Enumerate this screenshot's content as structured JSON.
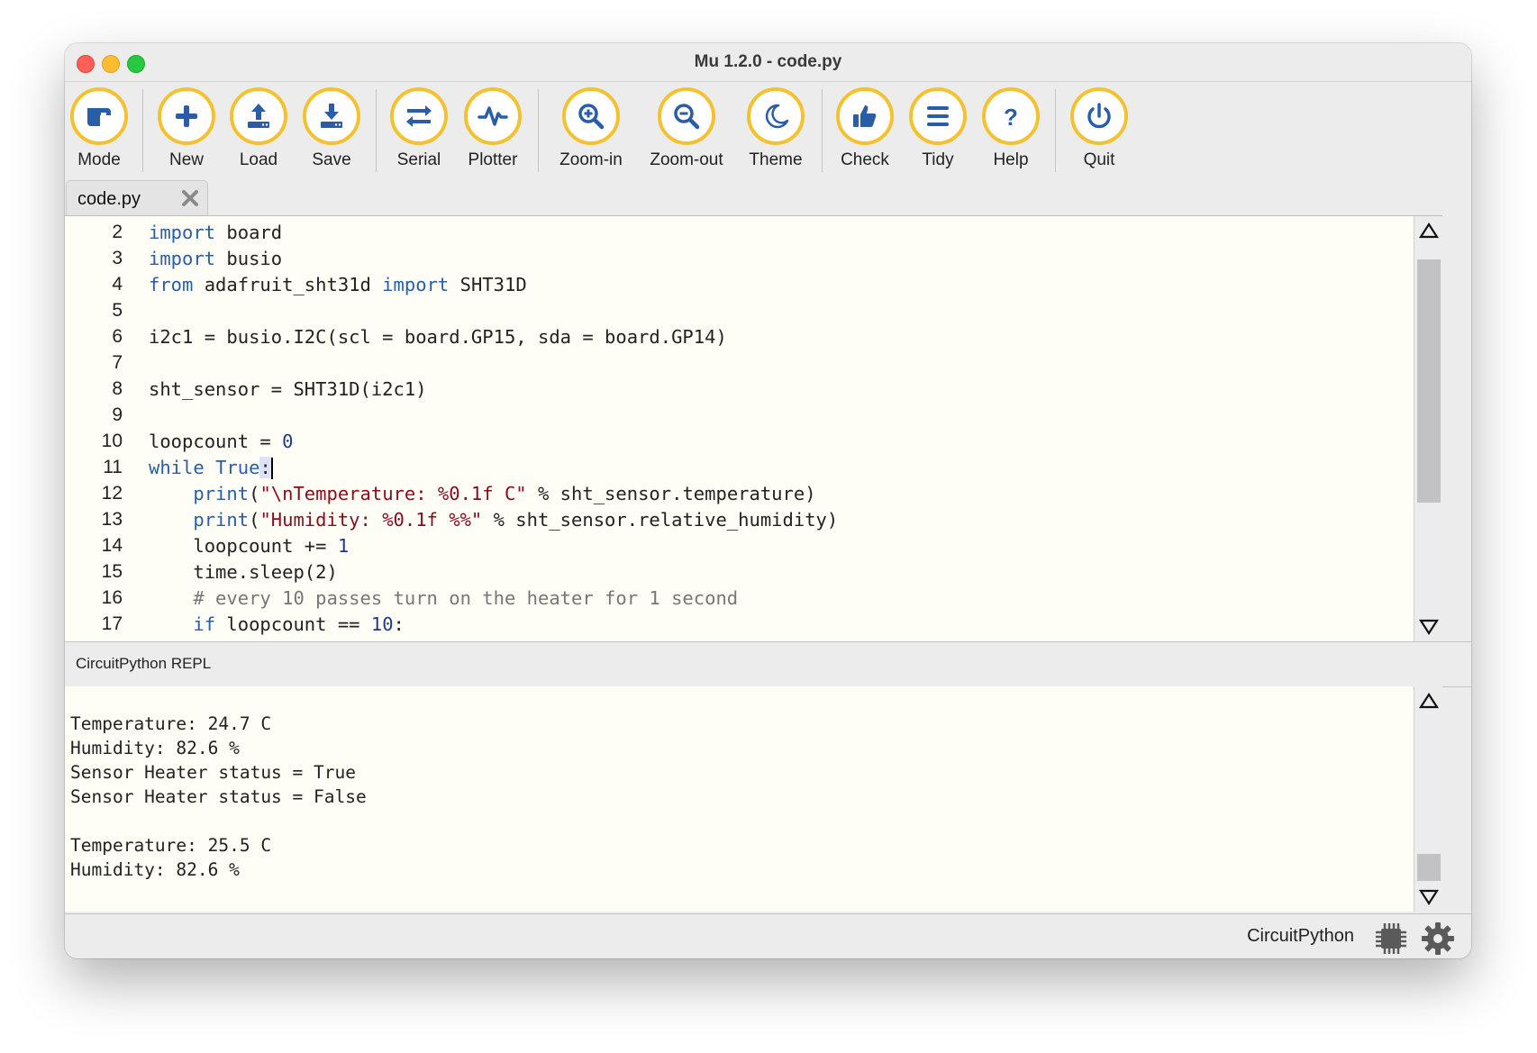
{
  "window": {
    "title": "Mu 1.2.0 - code.py"
  },
  "toolbar": {
    "buttons": [
      {
        "label": "Mode",
        "icon": "mode-icon"
      },
      {
        "label": "New",
        "icon": "plus-icon"
      },
      {
        "label": "Load",
        "icon": "upload-icon"
      },
      {
        "label": "Save",
        "icon": "download-icon"
      },
      {
        "label": "Serial",
        "icon": "swap-arrows-icon"
      },
      {
        "label": "Plotter",
        "icon": "pulse-icon"
      },
      {
        "label": "Zoom-in",
        "icon": "zoom-in-icon"
      },
      {
        "label": "Zoom-out",
        "icon": "zoom-out-icon"
      },
      {
        "label": "Theme",
        "icon": "moon-icon"
      },
      {
        "label": "Check",
        "icon": "thumbs-up-icon"
      },
      {
        "label": "Tidy",
        "icon": "lines-icon"
      },
      {
        "label": "Help",
        "icon": "question-icon"
      },
      {
        "label": "Quit",
        "icon": "power-icon"
      }
    ],
    "accent_color": "#f4c230",
    "icon_color": "#2a5da8"
  },
  "tab": {
    "name": "code.py"
  },
  "editor": {
    "line_numbers": [
      "2",
      "3",
      "4",
      "5",
      "6",
      "7",
      "8",
      "9",
      "10",
      "11",
      "12",
      "13",
      "14",
      "15",
      "16",
      "17"
    ],
    "lines": [
      "import board",
      "import busio",
      "from adafruit_sht31d import SHT31D",
      "",
      "i2c1 = busio.I2C(scl = board.GP15, sda = board.GP14)",
      "",
      "sht_sensor = SHT31D(i2c1)",
      "",
      "loopcount = 0",
      "while True:",
      "    print(\"\\nTemperature: %0.1f C\" % sht_sensor.temperature)",
      "    print(\"Humidity: %0.1f %%\" % sht_sensor.relative_humidity)",
      "    loopcount += 1",
      "    time.sleep(2)",
      "    # every 10 passes turn on the heater for 1 second",
      "    if loopcount == 10:"
    ]
  },
  "repl": {
    "title": "CircuitPython REPL",
    "lines": [
      "",
      "Temperature: 24.7 C",
      "Humidity: 82.6 %",
      "Sensor Heater status = True",
      "Sensor Heater status = False",
      "",
      "Temperature: 25.5 C",
      "Humidity: 82.6 %"
    ]
  },
  "status": {
    "mode": "CircuitPython"
  }
}
